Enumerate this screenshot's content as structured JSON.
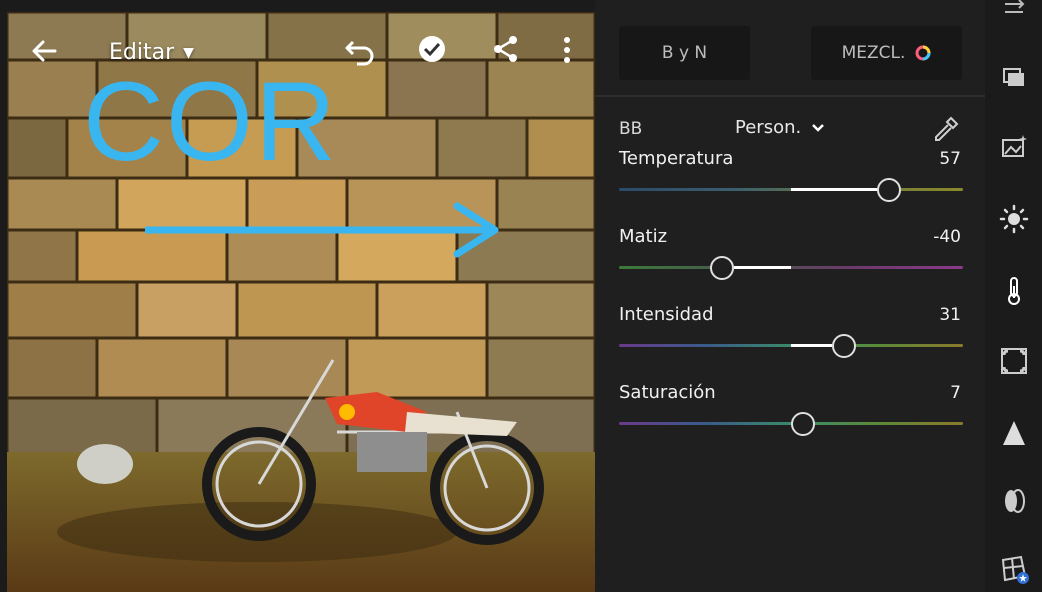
{
  "topbar": {
    "title": "Editar",
    "back_icon": "arrow-left-icon",
    "undo_icon": "undo-icon",
    "confirm_icon": "check-circle-icon",
    "share_icon": "share-icon",
    "more_icon": "more-vertical-icon"
  },
  "overlay": {
    "text": "COR",
    "color": "#39b6f0"
  },
  "panel": {
    "bw_button": "B y N",
    "mix_button": "MEZCL.",
    "wb_label": "BB",
    "wb_preset": "Person.",
    "sliders": [
      {
        "label": "Temperatura",
        "value": "57",
        "level": 0.785
      },
      {
        "label": "Matiz",
        "value": "-40",
        "level": 0.3
      },
      {
        "label": "Intensidad",
        "value": "31",
        "level": 0.655
      },
      {
        "label": "Saturación",
        "value": "7",
        "level": 0.535
      }
    ]
  },
  "rail": {
    "icons": [
      "swap-icon",
      "presets-icon",
      "auto-enhance-icon",
      "light-icon",
      "color-temperature-icon",
      "effects-icon",
      "detail-icon",
      "optics-icon",
      "geometry-icon"
    ]
  }
}
